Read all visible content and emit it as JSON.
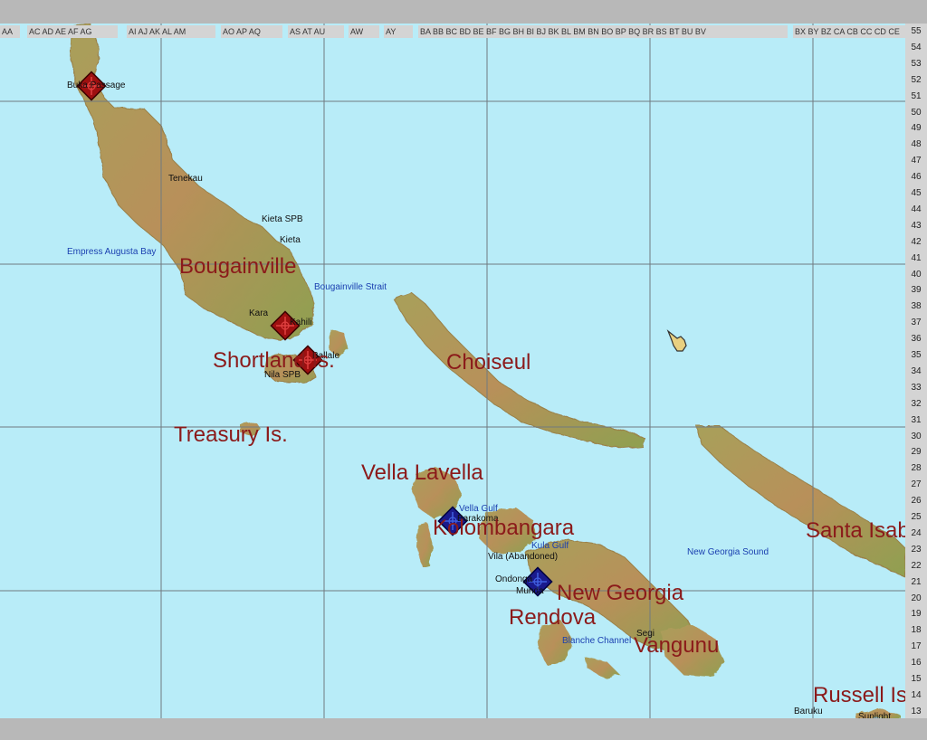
{
  "column_ruler": [
    {
      "label": "AA"
    },
    {
      "label": "AC AD AE AF AG"
    },
    {
      "label": "AI  AJ AK AL AM"
    },
    {
      "label": "AO AP AQ"
    },
    {
      "label": "AS AT AU"
    },
    {
      "label": "AW"
    },
    {
      "label": "AY"
    },
    {
      "label": "BA BB BC BD BE BF BG BH BI  BJ BK BL BM BN BO BP BQ BR BS BT BU BV"
    },
    {
      "label": "BX BY BZ CA CB CC CD CE"
    }
  ],
  "row_ruler": [
    "55",
    "54",
    "53",
    "52",
    "51",
    "50",
    "49",
    "48",
    "47",
    "46",
    "45",
    "44",
    "43",
    "42",
    "41",
    "40",
    "39",
    "38",
    "37",
    "36",
    "35",
    "34",
    "33",
    "32",
    "31",
    "30",
    "29",
    "28",
    "27",
    "26",
    "25",
    "24",
    "23",
    "22",
    "21",
    "20",
    "19",
    "18",
    "17",
    "16",
    "15",
    "14",
    "13"
  ],
  "big_labels": {
    "bougainville": "Bougainville",
    "shortland": "Shortland Is.",
    "choiseul": "Choiseul",
    "treasury": "Treasury Is.",
    "vella_lavella": "Vella Lavella",
    "kolombangara": "Kolombangara",
    "new_georgia": "New Georgia",
    "rendova": "Rendova",
    "vangunu": "Vangunu",
    "santa_isabel": "Santa Isab",
    "russell": "Russell Is"
  },
  "bases": {
    "buka": "Buka Passage",
    "tenekau": "Tenekau",
    "kieta_spb": "Kieta SPB",
    "kieta": "Kieta",
    "kara": "Kara",
    "kahili": "Kahili",
    "ballale": "Ballale",
    "nila_spb": "Nila SPB",
    "vila": "Vila (Abandoned)",
    "ondonga": "Ondonga",
    "munda": "Munda",
    "seghe": "Segi",
    "baruku": "Baruku",
    "sunlight": "Sunlight",
    "bakoma": "Barakoma"
  },
  "waters": {
    "empress_augusta": "Empress Augusta Bay",
    "bougainville_strait": "Bougainville Strait",
    "vella_gulf": "Vella Gulf",
    "kula_gulf": "Kula Gulf",
    "new_georgia_sound": "New Georgia Sound",
    "blanche_channel": "Blanche Channel"
  },
  "colors": {
    "sea": "#b8ecf8",
    "land": "#b89a58",
    "japanese_unit": "#9e1010",
    "allied_unit": "#1a1a8c",
    "grid": "#707a80"
  },
  "units": [
    {
      "side": "japanese",
      "name": "unit-buka"
    },
    {
      "side": "japanese",
      "name": "unit-kahili"
    },
    {
      "side": "japanese",
      "name": "unit-ballale"
    },
    {
      "side": "allied",
      "name": "unit-barakoma"
    },
    {
      "side": "allied",
      "name": "unit-munda"
    }
  ]
}
